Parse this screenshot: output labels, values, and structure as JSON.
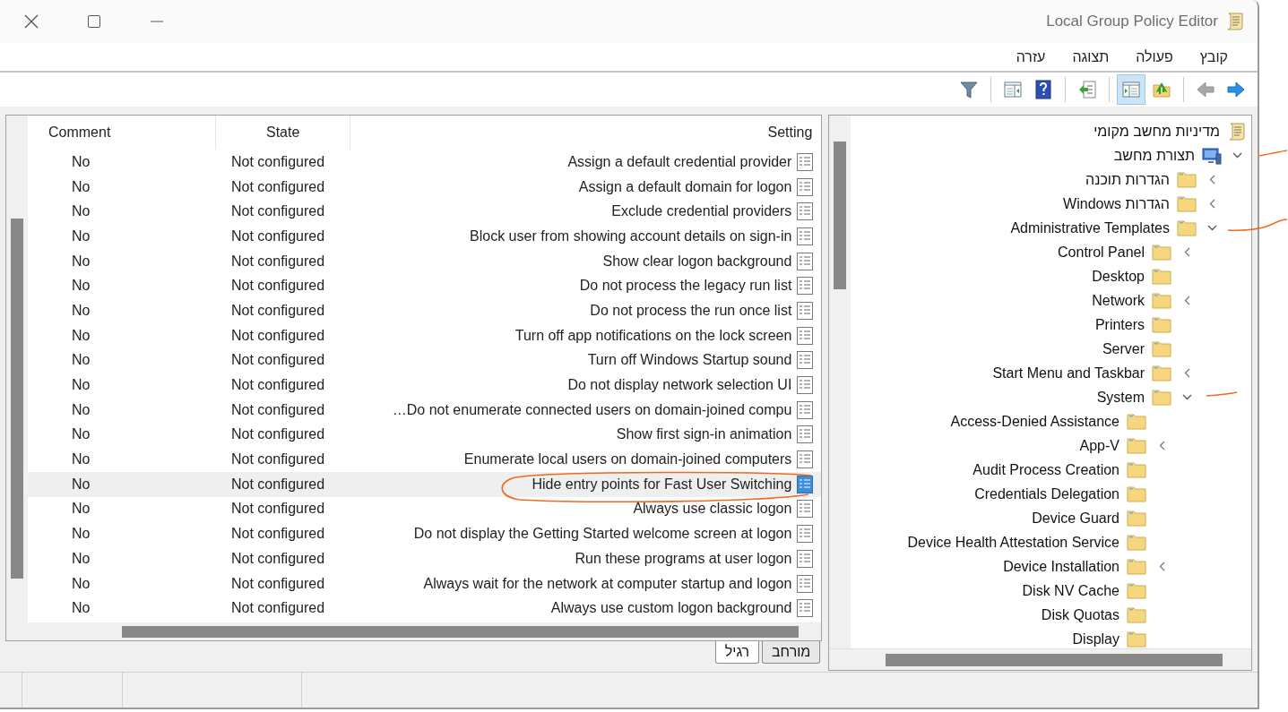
{
  "window": {
    "title": "Local Group Policy Editor"
  },
  "menu": [
    "קובץ",
    "פעולה",
    "תצוגה",
    "עזרה"
  ],
  "toolbar": [
    {
      "kind": "forward",
      "disabled": false,
      "pressed": false
    },
    {
      "kind": "back",
      "disabled": true,
      "pressed": false
    },
    {
      "kind": "separator"
    },
    {
      "kind": "up-folder",
      "disabled": false,
      "pressed": false
    },
    {
      "kind": "show-tree",
      "disabled": false,
      "pressed": true
    },
    {
      "kind": "separator"
    },
    {
      "kind": "export-list",
      "disabled": false,
      "pressed": false
    },
    {
      "kind": "separator"
    },
    {
      "kind": "help",
      "disabled": false,
      "pressed": false
    },
    {
      "kind": "action-pane",
      "disabled": false,
      "pressed": false
    },
    {
      "kind": "separator"
    },
    {
      "kind": "filter",
      "disabled": false,
      "pressed": false
    }
  ],
  "tree": [
    {
      "label": "מדיניות מחשב מקומי",
      "kind": "scroll",
      "expandable": false,
      "children": [
        {
          "label": "תצורת מחשב",
          "kind": "computer",
          "expandable": true,
          "expanded": true,
          "children": [
            {
              "label": "הגדרות תוכנה",
              "kind": "folder",
              "expandable": true,
              "expanded": false
            },
            {
              "label": "הגדרות Windows",
              "kind": "folder",
              "expandable": true,
              "expanded": false
            },
            {
              "label": "Administrative Templates",
              "kind": "folder",
              "expandable": true,
              "expanded": true,
              "children": [
                {
                  "label": "Control Panel",
                  "kind": "folder",
                  "expandable": true,
                  "expanded": false
                },
                {
                  "label": "Desktop",
                  "kind": "folder",
                  "expandable": false
                },
                {
                  "label": "Network",
                  "kind": "folder",
                  "expandable": true,
                  "expanded": false
                },
                {
                  "label": "Printers",
                  "kind": "folder",
                  "expandable": false
                },
                {
                  "label": "Server",
                  "kind": "folder",
                  "expandable": false
                },
                {
                  "label": "Start Menu and Taskbar",
                  "kind": "folder",
                  "expandable": true,
                  "expanded": false
                },
                {
                  "label": "System",
                  "kind": "folder",
                  "expandable": true,
                  "expanded": true,
                  "children": [
                    {
                      "label": "Access-Denied Assistance",
                      "kind": "folder",
                      "expandable": false
                    },
                    {
                      "label": "App-V",
                      "kind": "folder",
                      "expandable": true,
                      "expanded": false
                    },
                    {
                      "label": "Audit Process Creation",
                      "kind": "folder",
                      "expandable": false
                    },
                    {
                      "label": "Credentials Delegation",
                      "kind": "folder",
                      "expandable": false
                    },
                    {
                      "label": "Device Guard",
                      "kind": "folder",
                      "expandable": false
                    },
                    {
                      "label": "Device Health Attestation Service",
                      "kind": "folder",
                      "expandable": false
                    },
                    {
                      "label": "Device Installation",
                      "kind": "folder",
                      "expandable": true,
                      "expanded": false
                    },
                    {
                      "label": "Disk NV Cache",
                      "kind": "folder",
                      "expandable": false
                    },
                    {
                      "label": "Disk Quotas",
                      "kind": "folder",
                      "expandable": false
                    },
                    {
                      "label": "Display",
                      "kind": "folder",
                      "expandable": false
                    }
                  ]
                }
              ]
            }
          ]
        }
      ]
    }
  ],
  "details": {
    "columns": [
      "Comment",
      "State",
      "Setting"
    ],
    "rows": [
      {
        "setting": "Assign a default credential provider",
        "state": "Not configured",
        "comment": "No",
        "selected": false
      },
      {
        "setting": "Assign a default domain for logon",
        "state": "Not configured",
        "comment": "No",
        "selected": false
      },
      {
        "setting": "Exclude credential providers",
        "state": "Not configured",
        "comment": "No",
        "selected": false
      },
      {
        "setting": "Block user from showing account details on sign-in",
        "state": "Not configured",
        "comment": "No",
        "selected": false
      },
      {
        "setting": "Show clear logon background",
        "state": "Not configured",
        "comment": "No",
        "selected": false
      },
      {
        "setting": "Do not process the legacy run list",
        "state": "Not configured",
        "comment": "No",
        "selected": false
      },
      {
        "setting": "Do not process the run once list",
        "state": "Not configured",
        "comment": "No",
        "selected": false
      },
      {
        "setting": "Turn off app notifications on the lock screen",
        "state": "Not configured",
        "comment": "No",
        "selected": false
      },
      {
        "setting": "Turn off Windows Startup sound",
        "state": "Not configured",
        "comment": "No",
        "selected": false
      },
      {
        "setting": "Do not display network selection UI",
        "state": "Not configured",
        "comment": "No",
        "selected": false
      },
      {
        "setting": "Do not enumerate connected users on domain-joined compu…",
        "state": "Not configured",
        "comment": "No",
        "selected": false
      },
      {
        "setting": "Show first sign-in animation",
        "state": "Not configured",
        "comment": "No",
        "selected": false
      },
      {
        "setting": "Enumerate local users on domain-joined computers",
        "state": "Not configured",
        "comment": "No",
        "selected": false
      },
      {
        "setting": "Hide entry points for Fast User Switching",
        "state": "Not configured",
        "comment": "No",
        "selected": true
      },
      {
        "setting": "Always use classic logon",
        "state": "Not configured",
        "comment": "No",
        "selected": false
      },
      {
        "setting": "Do not display the Getting Started welcome screen at logon",
        "state": "Not configured",
        "comment": "No",
        "selected": false
      },
      {
        "setting": "Run these programs at user logon",
        "state": "Not configured",
        "comment": "No",
        "selected": false
      },
      {
        "setting": "Always wait for the network at computer startup and logon",
        "state": "Not configured",
        "comment": "No",
        "selected": false
      },
      {
        "setting": "Always use custom logon background",
        "state": "Not configured",
        "comment": "No",
        "selected": false
      }
    ]
  },
  "view_tabs": [
    {
      "label": "מורחב",
      "selected": false
    },
    {
      "label": "רגיל",
      "selected": true
    }
  ]
}
